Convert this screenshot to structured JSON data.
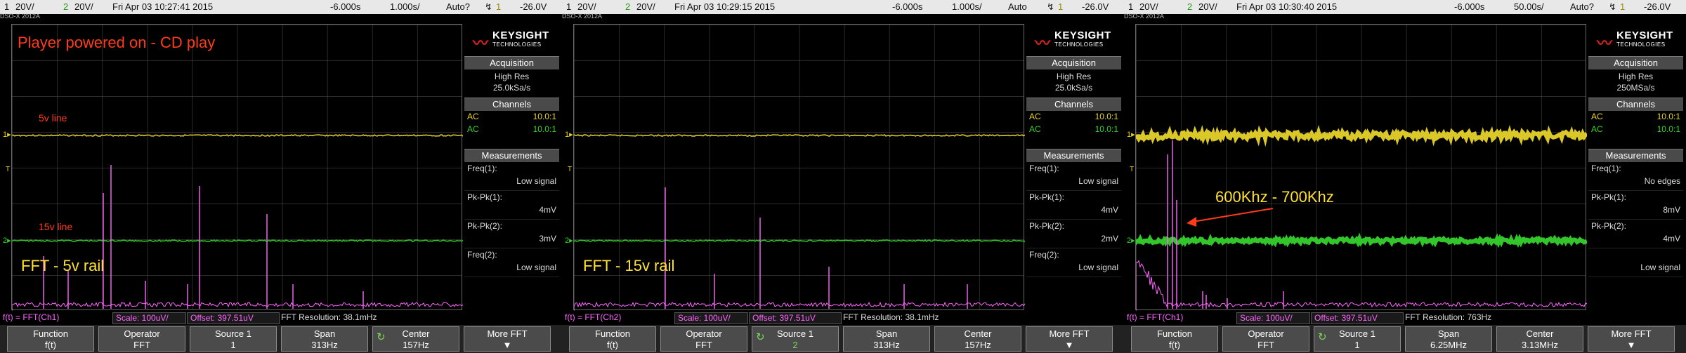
{
  "colors": {
    "ch1": "#e6d22a",
    "ch2": "#36d12c",
    "fft": "#ff66ff",
    "annot_red": "#ff3b1a",
    "annot_yellow": "#ffe22e"
  },
  "scopes": [
    {
      "topbar": {
        "ch1_num": "1",
        "ch1_scale": "20V/",
        "ch2_num": "2",
        "ch2_scale": "20V/",
        "model": "DSO-X 2012A",
        "datetime": "Fri Apr 03 10:27:41 2015",
        "trig_pos": "-6.000s",
        "timebase": "1.000s/",
        "mode": "Auto?",
        "trig_icon": "↯",
        "trig_ch": "1",
        "trig_level": "-26.0V"
      },
      "annotations": {
        "title": "Player powered on - CD play",
        "line1": "5v line",
        "line2": "15v line",
        "fft": "FFT - 5v rail"
      },
      "side": {
        "acq_header": "Acquisition",
        "acq_mode": "High Res",
        "acq_rate": "25.0kSa/s",
        "ch_header": "Channels",
        "ch1_coupling": "AC",
        "ch1_probe": "10.0:1",
        "ch2_coupling": "AC",
        "ch2_probe": "10.0:1",
        "meas_header": "Measurements",
        "m1_name": "Freq(1):",
        "m1_val": "Low signal",
        "m2_name": "Pk-Pk(1):",
        "m2_val": "4mV",
        "m3_name": "Pk-Pk(2):",
        "m3_val": "3mV",
        "m4_name": "Freq(2):",
        "m4_val": "Low signal"
      },
      "status": {
        "func": "f(t) = FFT(Ch1)",
        "scale": "Scale: 100uV/",
        "offset": "Offset: 397.51uV",
        "res": "FFT Resolution: 38.1mHz"
      },
      "softkeys": [
        {
          "a": "Function",
          "b": "f(t)"
        },
        {
          "a": "Operator",
          "b": "FFT"
        },
        {
          "a": "Source 1",
          "b": "1"
        },
        {
          "a": "Span",
          "b": "313Hz"
        },
        {
          "a": "Center",
          "b": "157Hz"
        },
        {
          "a": "More FFT",
          "b": ""
        }
      ]
    },
    {
      "topbar": {
        "ch1_num": "1",
        "ch1_scale": "20V/",
        "ch2_num": "2",
        "ch2_scale": "20V/",
        "model": "DSO-X 2012A",
        "datetime": "Fri Apr 03 10:29:15 2015",
        "trig_pos": "-6.000s",
        "timebase": "1.000s/",
        "mode": "Auto",
        "trig_icon": "↯",
        "trig_ch": "1",
        "trig_level": "-26.0V"
      },
      "annotations": {
        "fft": "FFT - 15v rail"
      },
      "side": {
        "acq_header": "Acquisition",
        "acq_mode": "High Res",
        "acq_rate": "25.0kSa/s",
        "ch_header": "Channels",
        "ch1_coupling": "AC",
        "ch1_probe": "10.0:1",
        "ch2_coupling": "AC",
        "ch2_probe": "10.0:1",
        "meas_header": "Measurements",
        "m1_name": "Freq(1):",
        "m1_val": "Low signal",
        "m2_name": "Pk-Pk(1):",
        "m2_val": "4mV",
        "m3_name": "Pk-Pk(2):",
        "m3_val": "2mV",
        "m4_name": "Freq(2):",
        "m4_val": "Low signal"
      },
      "status": {
        "func": "f(t) = FFT(Ch2)",
        "scale": "Scale: 100uV/",
        "offset": "Offset: 397.51uV",
        "res": "FFT Resolution: 38.1mHz"
      },
      "softkeys": [
        {
          "a": "Function",
          "b": "f(t)"
        },
        {
          "a": "Operator",
          "b": "FFT"
        },
        {
          "a": "Source 1",
          "b": "2"
        },
        {
          "a": "Span",
          "b": "313Hz"
        },
        {
          "a": "Center",
          "b": "157Hz"
        },
        {
          "a": "More FFT",
          "b": ""
        }
      ]
    },
    {
      "topbar": {
        "ch1_num": "1",
        "ch1_scale": "20V/",
        "ch2_num": "2",
        "ch2_scale": "20V/",
        "model": "DSO-X 2012A",
        "datetime": "Fri Apr 03 10:30:40 2015",
        "trig_pos": "-6.000s",
        "timebase": "50.00s/",
        "mode": "Auto?",
        "trig_icon": "↯",
        "trig_ch": "1",
        "trig_level": "-26.0V"
      },
      "annotations": {
        "freq": "600Khz - 700Khz"
      },
      "side": {
        "acq_header": "Acquisition",
        "acq_mode": "High Res",
        "acq_rate": "250MSa/s",
        "ch_header": "Channels",
        "ch1_coupling": "AC",
        "ch1_probe": "10.0:1",
        "ch2_coupling": "AC",
        "ch2_probe": "10.0:1",
        "meas_header": "Measurements",
        "m1_name": "Freq(1):",
        "m1_val": "No edges",
        "m2_name": "Pk-Pk(1):",
        "m2_val": "8mV",
        "m3_name": "Pk-Pk(2):",
        "m3_val": "4mV",
        "m4_name": "",
        "m4_val": "Low signal"
      },
      "status": {
        "func": "f(t) = FFT(Ch1)",
        "scale": "Scale: 100uV/",
        "offset": "Offset: 397.51uV",
        "res": "FFT Resolution: 763Hz"
      },
      "softkeys": [
        {
          "a": "Function",
          "b": "f(t)"
        },
        {
          "a": "Operator",
          "b": "FFT"
        },
        {
          "a": "Source 1",
          "b": "1"
        },
        {
          "a": "Span",
          "b": "6.25MHz"
        },
        {
          "a": "Center",
          "b": "3.13MHz"
        },
        {
          "a": "More FFT",
          "b": ""
        }
      ]
    }
  ],
  "logo": {
    "brand": "KEYSIGHT",
    "sub": "TECHNOLOGIES"
  }
}
